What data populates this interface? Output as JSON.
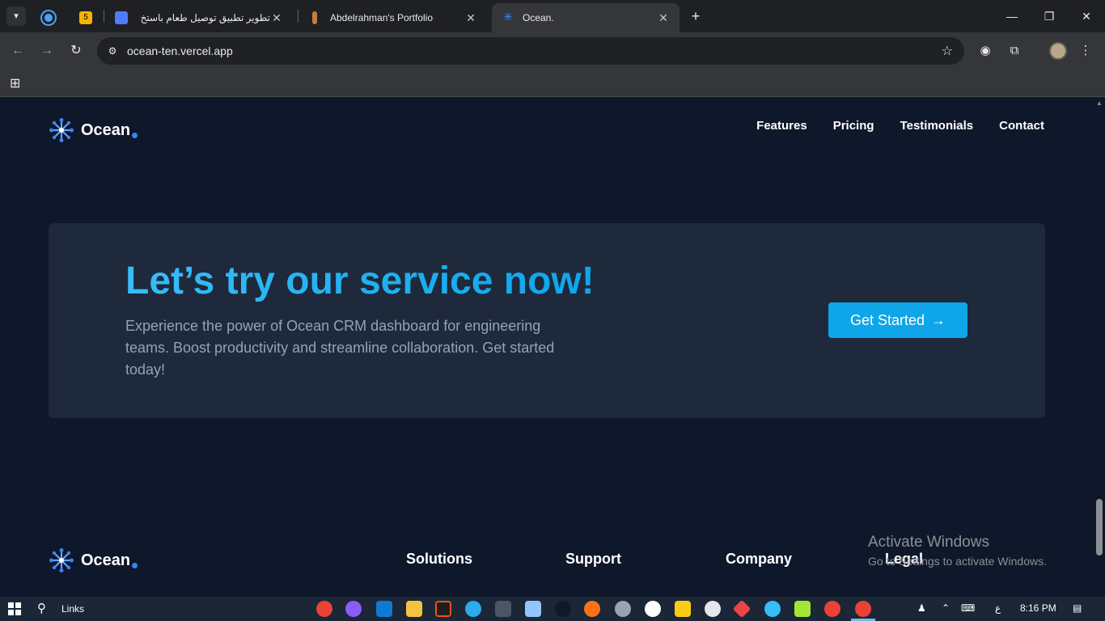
{
  "browser": {
    "tabs": [
      {
        "title": "",
        "favicon": "circle-app-icon",
        "color": "#4aa3f0",
        "pinned": true
      },
      {
        "title": "",
        "favicon": "five-badge-icon",
        "color": "#f4b400",
        "pinned": true
      },
      {
        "title": "تطوير تطبيق توصيل طعام باستخ",
        "favicon": "w-logo-icon",
        "color": "#4f7cff"
      },
      {
        "title": "Abdelrahman's Portfolio",
        "favicon": "candle-icon",
        "color": "#c97a3b"
      },
      {
        "title": "Ocean.",
        "favicon": "ocean-logo-icon",
        "color": "#3b82f6",
        "active": true
      }
    ],
    "url": "ocean-ten.vercel.app",
    "new_tab": "+",
    "window_controls": {
      "minimize": "—",
      "restore": "❐",
      "close": "✕"
    }
  },
  "site": {
    "brand": "Ocean",
    "nav": [
      "Features",
      "Pricing",
      "Testimonials",
      "Contact"
    ],
    "cta": {
      "heading": "Let’s try our service now!",
      "body": "Experience the power of Ocean CRM dashboard for engineering teams. Boost productivity and streamline collaboration. Get started today!",
      "button": "Get Started",
      "button_arrow": "→"
    },
    "footer": {
      "brand": "Ocean",
      "columns": [
        "Solutions",
        "Support",
        "Company",
        "Legal"
      ]
    },
    "accent": "#0ea5e9",
    "background": "#0f172a",
    "card": "#1e293b"
  },
  "watermark": {
    "line1": "Activate Windows",
    "line2": "Go to Settings to activate Windows."
  },
  "taskbar": {
    "search_label": "Links",
    "clock": "8:16 PM",
    "lang": "ع"
  }
}
